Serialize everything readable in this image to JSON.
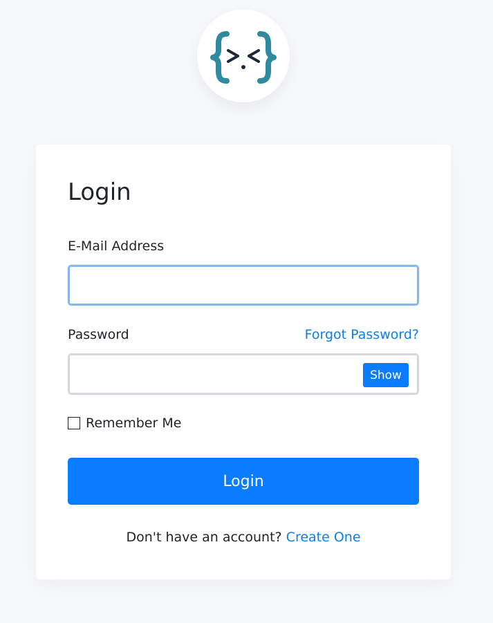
{
  "logo": {
    "icon": "code-braces-face-icon",
    "brace_color": "#2f8aa0",
    "face_color": "#1b2a38"
  },
  "card": {
    "title": "Login"
  },
  "email": {
    "label": "E-Mail Address",
    "value": "",
    "placeholder": ""
  },
  "password": {
    "label": "Password",
    "forgot_link": "Forgot Password?",
    "value": "",
    "placeholder": "",
    "show_button": "Show"
  },
  "remember": {
    "label": "Remember Me",
    "checked": false
  },
  "login_button": "Login",
  "signup": {
    "prompt": "Don't have an account?",
    "link": "Create One"
  },
  "colors": {
    "primary": "#0a7cff",
    "link": "#0d7ee8",
    "background": "#f7f8fa"
  }
}
